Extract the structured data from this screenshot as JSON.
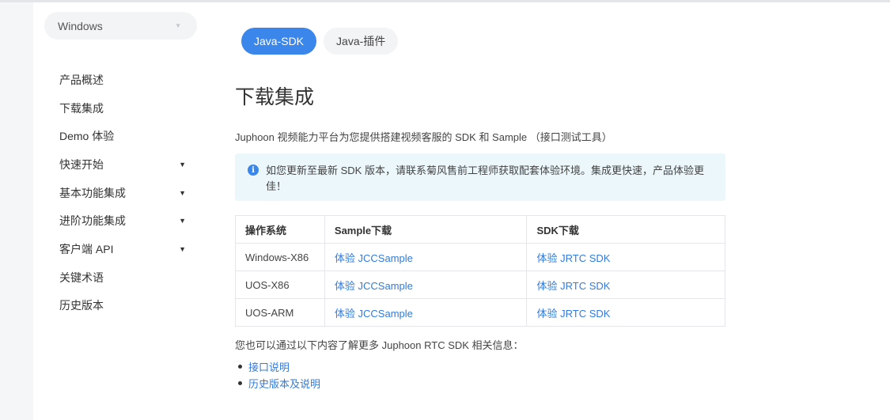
{
  "sidebar": {
    "os_select": {
      "value": "Windows",
      "caret": "▼"
    },
    "items": [
      {
        "label": "产品概述",
        "caret": ""
      },
      {
        "label": "下载集成",
        "caret": ""
      },
      {
        "label": "Demo 体验",
        "caret": ""
      },
      {
        "label": "快速开始",
        "caret": "▼"
      },
      {
        "label": "基本功能集成",
        "caret": "▼"
      },
      {
        "label": "进阶功能集成",
        "caret": "▼"
      },
      {
        "label": "客户端 API",
        "caret": "▼"
      },
      {
        "label": "关键术语",
        "caret": ""
      },
      {
        "label": "历史版本",
        "caret": ""
      }
    ]
  },
  "tabs": [
    {
      "label": "Java-SDK",
      "active": true
    },
    {
      "label": "Java-插件",
      "active": false
    }
  ],
  "main": {
    "title": "下载集成",
    "description": "Juphoon 视频能力平台为您提供搭建视频客服的 SDK 和 Sample （接口测试工具）",
    "notice": {
      "icon": "info-icon",
      "text": "如您更新至最新 SDK 版本，请联系菊风售前工程师获取配套体验环境。集成更快速，产品体验更佳！"
    },
    "table": {
      "headers": [
        "操作系统",
        "Sample下载",
        "SDK下载"
      ],
      "rows": [
        {
          "os": "Windows-X86",
          "sample": "体验 JCCSample",
          "sdk": "体验 JRTC SDK"
        },
        {
          "os": "UOS-X86",
          "sample": "体验 JCCSample",
          "sdk": "体验 JRTC SDK"
        },
        {
          "os": "UOS-ARM",
          "sample": "体验 JCCSample",
          "sdk": "体验 JRTC SDK"
        }
      ]
    },
    "more_text": "您也可以通过以下内容了解更多 Juphoon RTC SDK 相关信息：",
    "links": [
      {
        "label": "接口说明"
      },
      {
        "label": "历史版本及说明"
      }
    ]
  },
  "colors": {
    "accent": "#3b86ea",
    "link": "#2f7bdf",
    "notice_bg": "#ebf7fb",
    "page_bg": "#f5f6f8"
  }
}
